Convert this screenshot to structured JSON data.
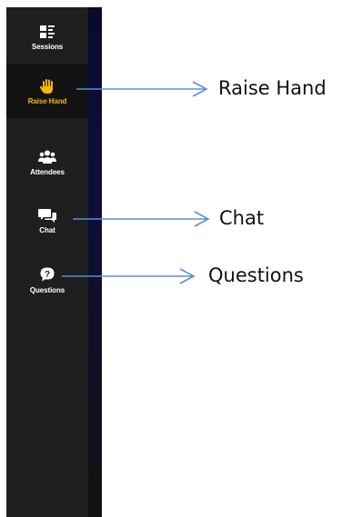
{
  "sidebar": {
    "items": [
      {
        "id": "sessions",
        "label": "Sessions",
        "icon": "sessions-icon",
        "active": false
      },
      {
        "id": "raise-hand",
        "label": "Raise Hand",
        "icon": "hand-icon",
        "active": true
      },
      {
        "id": "attendees",
        "label": "Attendees",
        "icon": "attendees-icon",
        "active": false
      },
      {
        "id": "chat",
        "label": "Chat",
        "icon": "chat-icon",
        "active": false
      },
      {
        "id": "questions",
        "label": "Questions",
        "icon": "question-icon",
        "active": false
      }
    ],
    "colors": {
      "background": "#1f1f1f",
      "active": "#f5b800",
      "text": "#ffffff"
    }
  },
  "annotations": [
    {
      "target": "raise-hand",
      "text": "Raise Hand",
      "arrow_color": "#5b8fd6"
    },
    {
      "target": "chat",
      "text": "Chat",
      "arrow_color": "#5b8fd6"
    },
    {
      "target": "questions",
      "text": "Questions",
      "arrow_color": "#5b8fd6"
    }
  ]
}
